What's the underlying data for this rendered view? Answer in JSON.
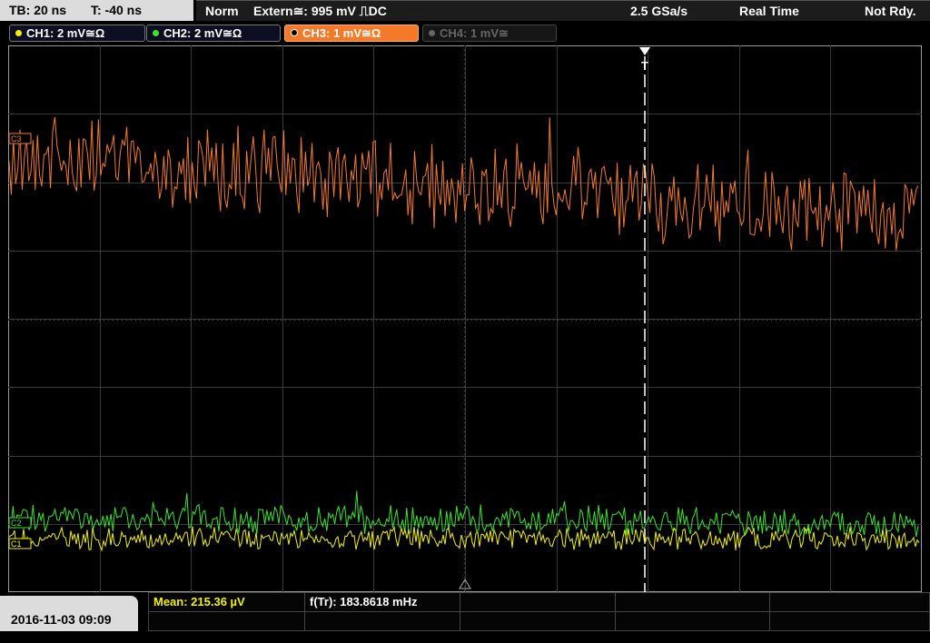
{
  "header": {
    "timebase": "TB: 20 ns",
    "trigger_time": "T: -40 ns",
    "trigger_mode": "Norm",
    "trigger_source": "Extern≅: 995 mV ⎍DC",
    "sample_rate": "2.5 GSa/s",
    "acq_mode": "Real Time",
    "status": "Not Rdy."
  },
  "channels": [
    {
      "label": "CH1: 2 mV≅Ω",
      "color": "#f2f200",
      "state": "on"
    },
    {
      "label": "CH2: 2 mV≅Ω",
      "color": "#35e62b",
      "state": "on"
    },
    {
      "label": "CH3: 1 mV≅Ω",
      "color": "#f47a2a",
      "state": "active"
    },
    {
      "label": "CH4: 1 mV≅",
      "color": "#666666",
      "state": "off"
    }
  ],
  "markers": {
    "trigger": "T",
    "ch3": "C3",
    "ch2": "C2",
    "ch1": "C1"
  },
  "footer": {
    "datetime": "2016-11-03 09:09",
    "mean": "Mean: 215.36 µV",
    "freq": "f(Tr): 183.8618 mHz"
  }
}
